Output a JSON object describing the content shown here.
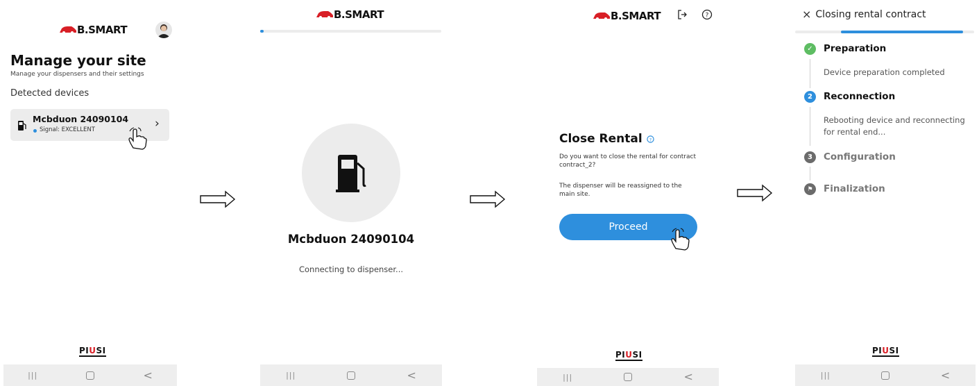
{
  "brand": {
    "logo_text": "B.SMART",
    "footer_logo": "PIUSI",
    "accent": "#2e8fdd",
    "brand_red": "#d81f26"
  },
  "nav": {
    "recent": "|||",
    "home": "",
    "back": "<"
  },
  "screen1": {
    "title": "Manage your site",
    "subtitle": "Manage your dispensers and their settings",
    "section": "Detected devices",
    "device": {
      "name": "Mcbduon 24090104",
      "signal": "Signal: EXCELLENT",
      "icon": "fuel-pump-icon"
    }
  },
  "screen2": {
    "device_name": "Mcbduon 24090104",
    "status": "Connecting to dispenser...",
    "progress": 0.01
  },
  "screen3": {
    "title": "Close Rental",
    "question": "Do you want to close the rental for contract contract_2?",
    "note": "The dispenser will be reassigned to the main site.",
    "proceed_label": "Proceed"
  },
  "screen4": {
    "header": "Closing rental contract",
    "close_icon": "×",
    "progress": 0.5,
    "steps": [
      {
        "number": "✓",
        "title": "Preparation",
        "desc": "Device preparation completed",
        "state": "done"
      },
      {
        "number": "2",
        "title": "Reconnection",
        "desc": "Rebooting device and reconnecting for rental end...",
        "state": "active"
      },
      {
        "number": "3",
        "title": "Configuration",
        "desc": "",
        "state": "pending"
      },
      {
        "number": "⚑",
        "title": "Finalization",
        "desc": "",
        "state": "pending"
      }
    ]
  }
}
